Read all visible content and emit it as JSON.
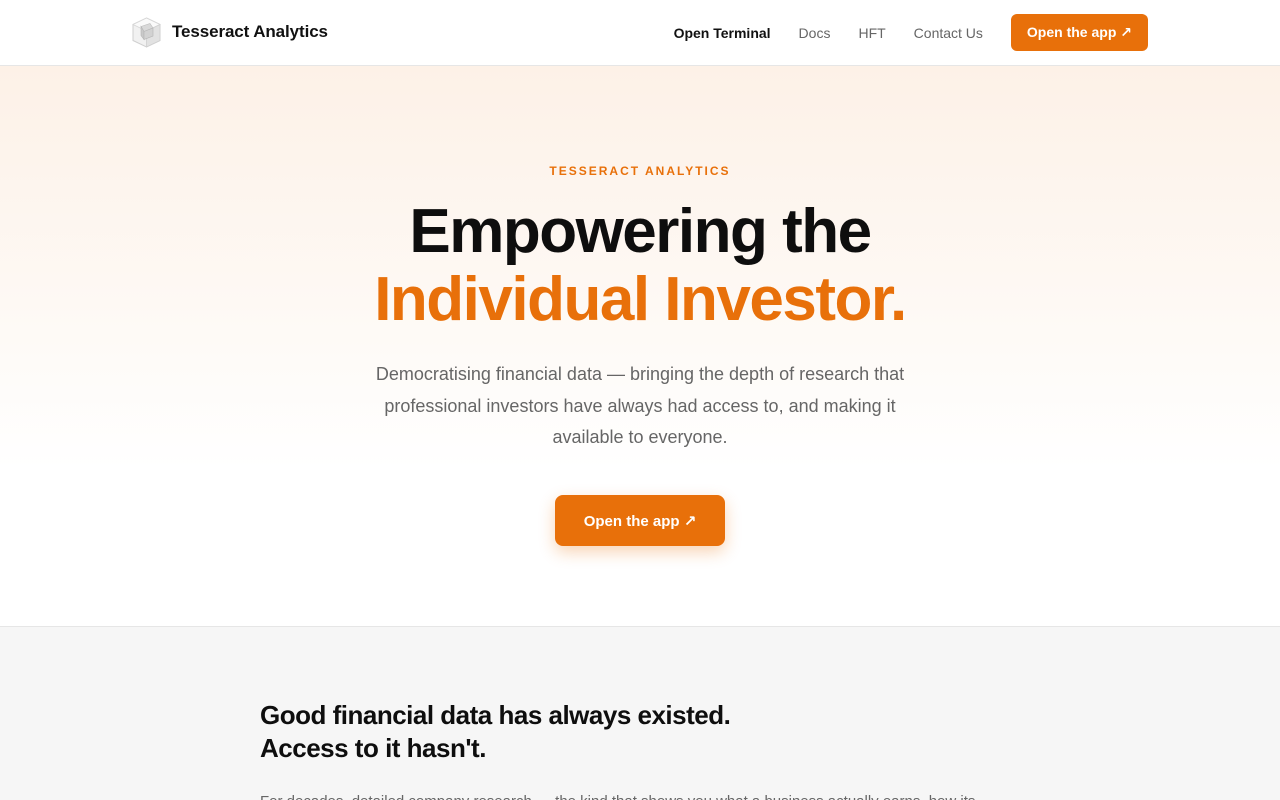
{
  "header": {
    "brand_name": "Tesseract Analytics",
    "brand_icon": "cube-icon",
    "nav": [
      {
        "label": "Open Terminal",
        "active": true
      },
      {
        "label": "Docs",
        "active": false
      },
      {
        "label": "HFT",
        "active": false
      },
      {
        "label": "Contact Us",
        "active": false
      }
    ],
    "cta_label": "Open the app ↗"
  },
  "hero": {
    "eyebrow": "TESSERACT ANALYTICS",
    "title_line1": "Empowering the",
    "title_line2": "Individual Investor.",
    "subtitle": "Democratising financial data — bringing the depth of research that professional investors have always had access to, and making it available to everyone.",
    "cta_label": "Open the app ↗"
  },
  "access_section": {
    "title_line1": "Good financial data has always existed.",
    "title_line2": "Access to it hasn't.",
    "body": "For decades, detailed company research — the kind that shows you what a business actually earns, how its"
  },
  "colors": {
    "accent": "#e8700a",
    "text_primary": "#0e0e0e",
    "text_muted": "#666666",
    "section_bg": "#f6f6f6"
  }
}
